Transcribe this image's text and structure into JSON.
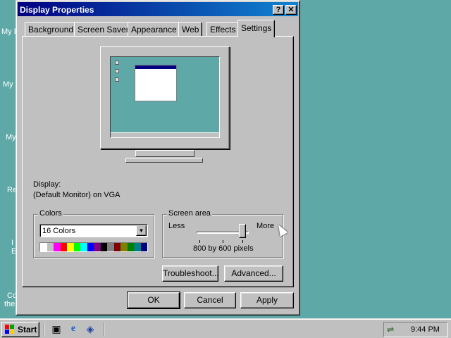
{
  "desktop": {
    "labels": [
      "My D",
      "My",
      "My",
      "Re",
      "I",
      "E",
      "Co",
      "the"
    ]
  },
  "dialog": {
    "title": "Display Properties",
    "help_label": "?",
    "close_label": "✕",
    "tabs": [
      {
        "label": "Background"
      },
      {
        "label": "Screen Saver"
      },
      {
        "label": "Appearance"
      },
      {
        "label": "Web"
      },
      {
        "label": "Effects"
      },
      {
        "label": "Settings"
      }
    ],
    "active_tab": "Settings",
    "display_label": "Display:",
    "display_value": "(Default Monitor) on VGA",
    "colors": {
      "legend": "Colors",
      "selected": "16 Colors",
      "palette": [
        "#ffffff",
        "#c0c0c0",
        "#ff00ff",
        "#ff0000",
        "#ffff00",
        "#00ff00",
        "#00ffff",
        "#0000ff",
        "#800080",
        "#000000",
        "#808080",
        "#800000",
        "#808000",
        "#008000",
        "#008080",
        "#000080"
      ]
    },
    "screen_area": {
      "legend": "Screen area",
      "less_label": "Less",
      "more_label": "More",
      "resolution": "800 by 600 pixels",
      "slider_value": 2,
      "slider_max": 2
    },
    "troubleshoot_label": "Troubleshoot...",
    "advanced_label": "Advanced...",
    "ok_label": "OK",
    "cancel_label": "Cancel",
    "apply_label": "Apply"
  },
  "taskbar": {
    "start_label": "Start",
    "quicklaunch": [
      "desktop-icon",
      "ie-icon",
      "channels-icon"
    ],
    "clock": "9:44 PM"
  }
}
